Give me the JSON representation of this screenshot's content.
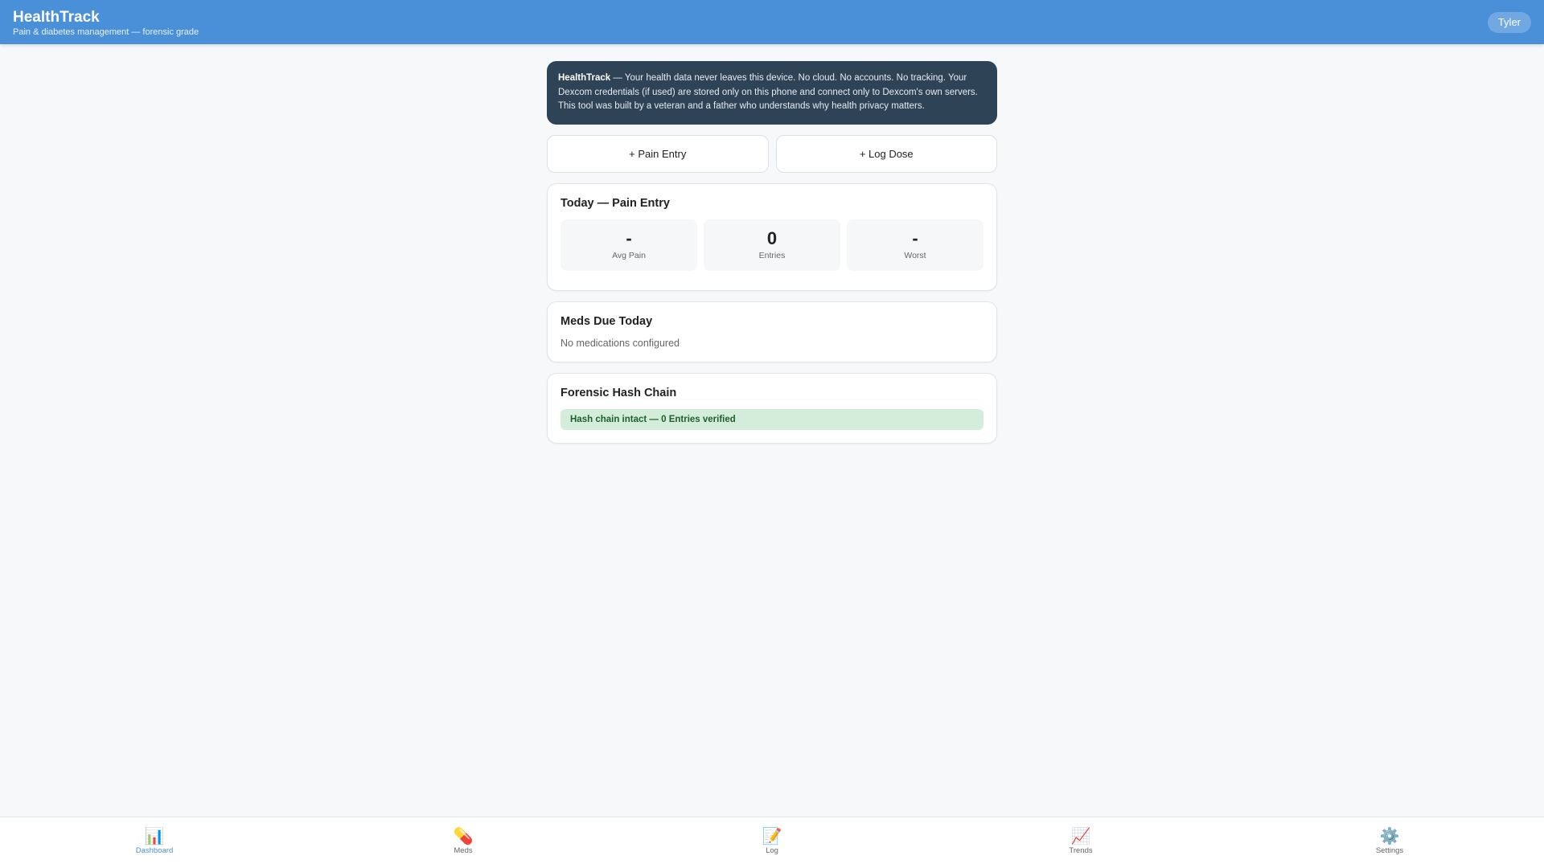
{
  "header": {
    "title": "HealthTrack",
    "subtitle": "Pain & diabetes management — forensic grade",
    "user": "Tyler"
  },
  "info": {
    "brand": "HealthTrack",
    "text": " — Your health data never leaves this device. No cloud. No accounts. No tracking. Your Dexcom credentials (if used) are stored only on this phone and connect only to Dexcom's own servers. This tool was built by a veteran and a father who understands why health privacy matters."
  },
  "actions": {
    "pain_entry": "+ Pain Entry",
    "log_dose": "+ Log Dose"
  },
  "today": {
    "title": "Today — Pain Entry",
    "stats": [
      {
        "value": "-",
        "label": "Avg Pain"
      },
      {
        "value": "0",
        "label": "Entries"
      },
      {
        "value": "-",
        "label": "Worst"
      }
    ]
  },
  "meds": {
    "title": "Meds Due Today",
    "empty": "No medications configured"
  },
  "hash": {
    "title": "Forensic Hash Chain",
    "status": "Hash chain intact — 0 Entries verified"
  },
  "nav": [
    {
      "icon": "📊",
      "label": "Dashboard"
    },
    {
      "icon": "💊",
      "label": "Meds"
    },
    {
      "icon": "📝",
      "label": "Log"
    },
    {
      "icon": "📈",
      "label": "Trends"
    },
    {
      "icon": "⚙️",
      "label": "Settings"
    }
  ],
  "colors": {
    "accent": "#4a90d9",
    "banner": "#2f4357",
    "success_bg": "#d4edda",
    "success_text": "#1e5e2c"
  }
}
